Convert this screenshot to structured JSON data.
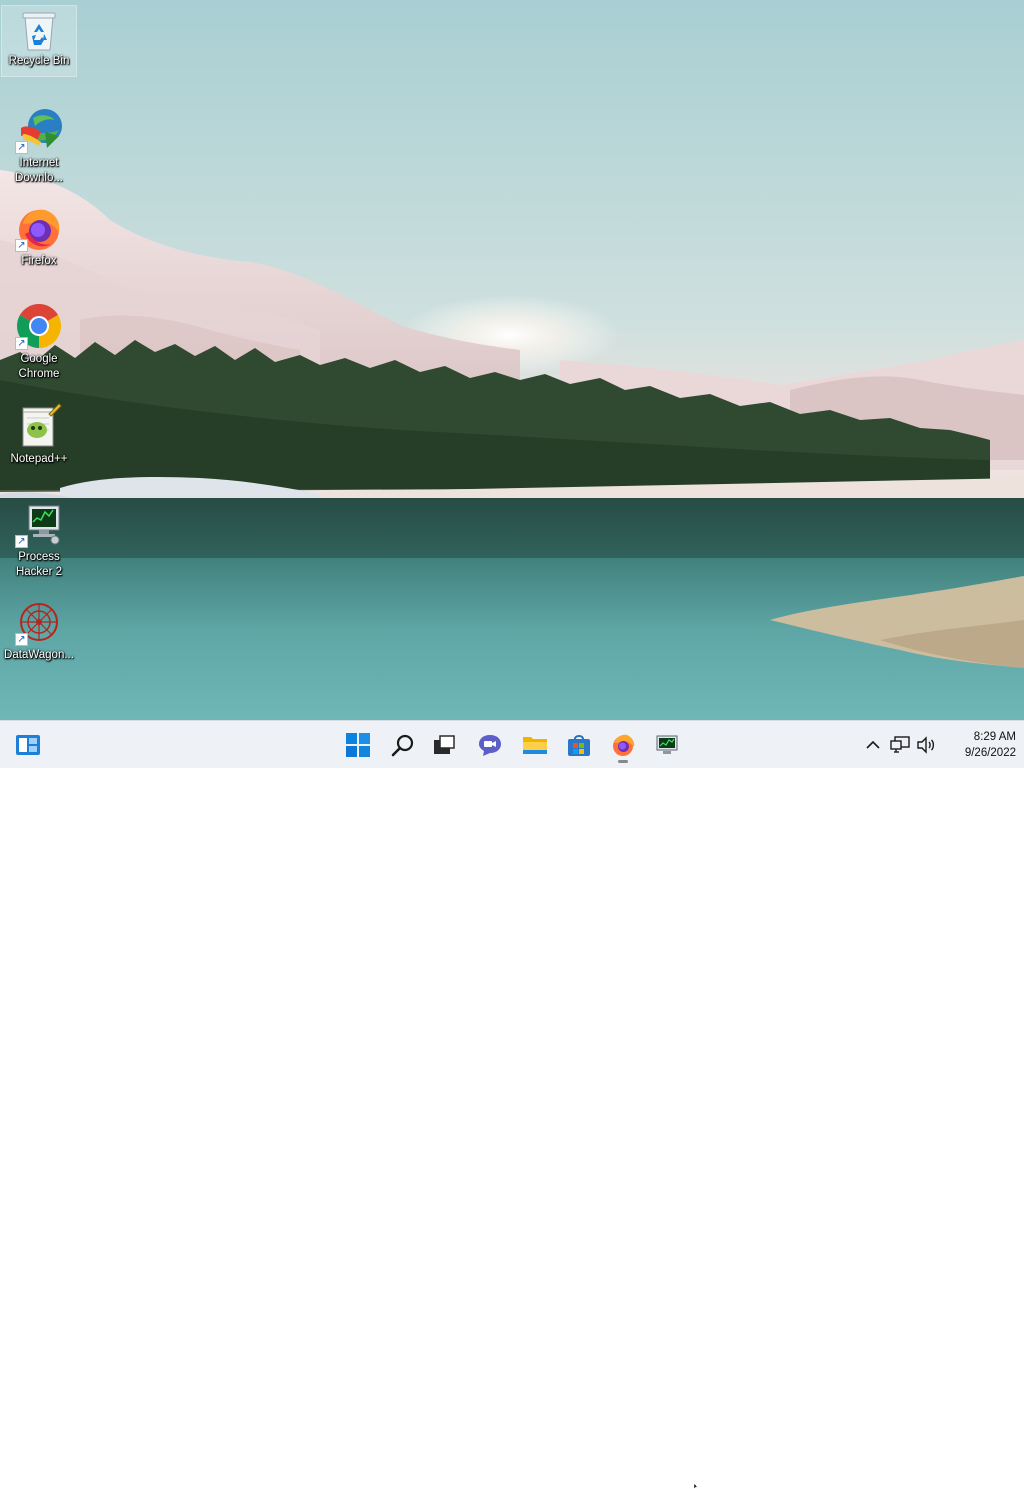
{
  "desktop": {
    "icons": [
      {
        "label": "Recycle Bin",
        "icon": "recycle-bin-icon",
        "shortcut": false,
        "selected": true
      },
      {
        "label": "Internet Downlo...",
        "icon": "internet-download-manager-icon",
        "shortcut": true
      },
      {
        "label": "Firefox",
        "icon": "firefox-icon",
        "shortcut": true
      },
      {
        "label": "Google Chrome",
        "icon": "chrome-icon",
        "shortcut": true
      },
      {
        "label": "Notepad++",
        "icon": "notepad-plus-plus-icon",
        "shortcut": false
      },
      {
        "label": "Process Hacker 2",
        "icon": "process-hacker-icon",
        "shortcut": true
      },
      {
        "label": "DataWagon...",
        "icon": "datawagon-icon",
        "shortcut": true
      }
    ]
  },
  "taskbar": {
    "widgets_icon": "widgets-icon",
    "apps": [
      {
        "name": "start",
        "icon": "windows-start-icon"
      },
      {
        "name": "search",
        "icon": "search-icon"
      },
      {
        "name": "task-view",
        "icon": "task-view-icon"
      },
      {
        "name": "chat",
        "icon": "teams-chat-icon"
      },
      {
        "name": "file-explorer",
        "icon": "file-explorer-icon"
      },
      {
        "name": "store",
        "icon": "microsoft-store-icon"
      },
      {
        "name": "firefox",
        "icon": "firefox-icon",
        "running": true
      },
      {
        "name": "process-hacker",
        "icon": "process-hacker-icon"
      }
    ],
    "tray": {
      "chevron_icon": "chevron-up-icon",
      "network_icon": "network-icon",
      "volume_icon": "volume-icon"
    },
    "clock": {
      "time": "8:29 AM",
      "date": "9/26/2022"
    }
  },
  "colors": {
    "taskbar_bg": "#eef1f5",
    "accent": "#0078d4"
  }
}
